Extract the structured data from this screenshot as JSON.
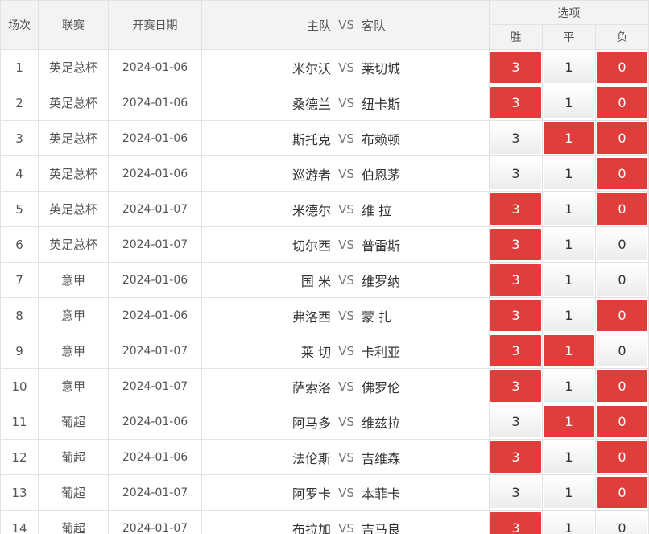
{
  "header": {
    "no": "场次",
    "league": "联赛",
    "date": "开赛日期",
    "home": "主队",
    "vs": "VS",
    "away": "客队",
    "options": "选项",
    "win": "胜",
    "draw": "平",
    "lose": "负"
  },
  "colors": {
    "selected": "#e03d3d",
    "header_bg": "#f3f3f3",
    "border": "#e2e2e2"
  },
  "rows": [
    {
      "no": "1",
      "league": "英足总杯",
      "date": "2024-01-06",
      "home": "米尔沃",
      "vs": "VS",
      "away": "莱切城",
      "win": "3",
      "draw": "1",
      "lose": "0",
      "sel": [
        true,
        false,
        true
      ]
    },
    {
      "no": "2",
      "league": "英足总杯",
      "date": "2024-01-06",
      "home": "桑德兰",
      "vs": "VS",
      "away": "纽卡斯",
      "win": "3",
      "draw": "1",
      "lose": "0",
      "sel": [
        true,
        false,
        true
      ]
    },
    {
      "no": "3",
      "league": "英足总杯",
      "date": "2024-01-06",
      "home": "斯托克",
      "vs": "VS",
      "away": "布赖顿",
      "win": "3",
      "draw": "1",
      "lose": "0",
      "sel": [
        false,
        true,
        true
      ]
    },
    {
      "no": "4",
      "league": "英足总杯",
      "date": "2024-01-06",
      "home": "巡游者",
      "vs": "VS",
      "away": "伯恩茅",
      "win": "3",
      "draw": "1",
      "lose": "0",
      "sel": [
        false,
        false,
        true
      ]
    },
    {
      "no": "5",
      "league": "英足总杯",
      "date": "2024-01-07",
      "home": "米德尔",
      "vs": "VS",
      "away": "维 拉",
      "win": "3",
      "draw": "1",
      "lose": "0",
      "sel": [
        true,
        false,
        true
      ]
    },
    {
      "no": "6",
      "league": "英足总杯",
      "date": "2024-01-07",
      "home": "切尔西",
      "vs": "VS",
      "away": "普雷斯",
      "win": "3",
      "draw": "1",
      "lose": "0",
      "sel": [
        true,
        false,
        false
      ]
    },
    {
      "no": "7",
      "league": "意甲",
      "date": "2024-01-06",
      "home": "国 米",
      "vs": "VS",
      "away": "维罗纳",
      "win": "3",
      "draw": "1",
      "lose": "0",
      "sel": [
        true,
        false,
        false
      ]
    },
    {
      "no": "8",
      "league": "意甲",
      "date": "2024-01-06",
      "home": "弗洛西",
      "vs": "VS",
      "away": "蒙 扎",
      "win": "3",
      "draw": "1",
      "lose": "0",
      "sel": [
        true,
        false,
        true
      ]
    },
    {
      "no": "9",
      "league": "意甲",
      "date": "2024-01-07",
      "home": "莱 切",
      "vs": "VS",
      "away": "卡利亚",
      "win": "3",
      "draw": "1",
      "lose": "0",
      "sel": [
        true,
        true,
        false
      ]
    },
    {
      "no": "10",
      "league": "意甲",
      "date": "2024-01-07",
      "home": "萨索洛",
      "vs": "VS",
      "away": "佛罗伦",
      "win": "3",
      "draw": "1",
      "lose": "0",
      "sel": [
        true,
        false,
        true
      ]
    },
    {
      "no": "11",
      "league": "葡超",
      "date": "2024-01-06",
      "home": "阿马多",
      "vs": "VS",
      "away": "维兹拉",
      "win": "3",
      "draw": "1",
      "lose": "0",
      "sel": [
        false,
        true,
        true
      ]
    },
    {
      "no": "12",
      "league": "葡超",
      "date": "2024-01-06",
      "home": "法伦斯",
      "vs": "VS",
      "away": "吉维森",
      "win": "3",
      "draw": "1",
      "lose": "0",
      "sel": [
        true,
        false,
        true
      ]
    },
    {
      "no": "13",
      "league": "葡超",
      "date": "2024-01-07",
      "home": "阿罗卡",
      "vs": "VS",
      "away": "本菲卡",
      "win": "3",
      "draw": "1",
      "lose": "0",
      "sel": [
        false,
        false,
        true
      ]
    },
    {
      "no": "14",
      "league": "葡超",
      "date": "2024-01-07",
      "home": "布拉加",
      "vs": "VS",
      "away": "吉马良",
      "win": "3",
      "draw": "1",
      "lose": "0",
      "sel": [
        true,
        false,
        false
      ]
    }
  ]
}
